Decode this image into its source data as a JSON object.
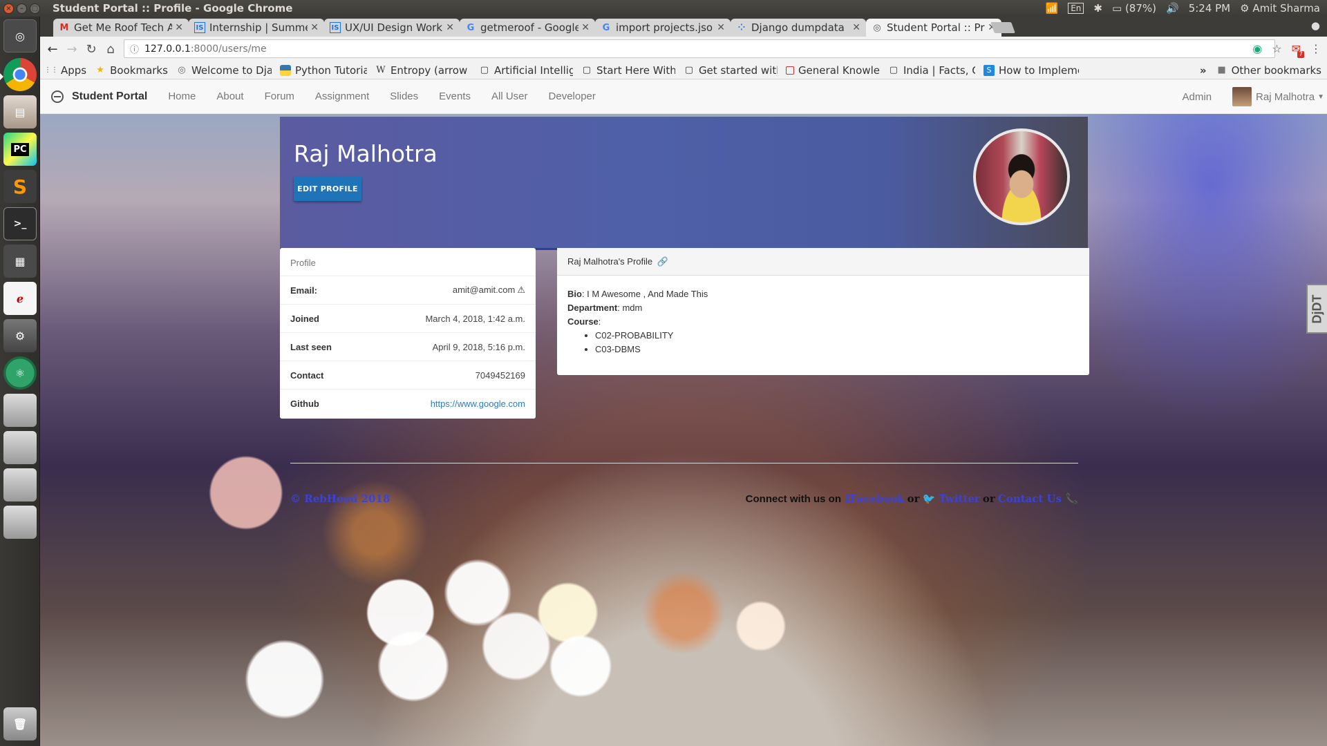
{
  "os": {
    "window_title": "Student Portal :: Profile - Google Chrome",
    "keyboard": "En",
    "battery": "(87%)",
    "time": "5:24 PM",
    "user": "Amit Sharma"
  },
  "launcher": {
    "items": [
      "ubuntu-dash",
      "chrome",
      "files",
      "pycharm",
      "sublime-text",
      "terminal",
      "workspace",
      "disk-utility",
      "settings",
      "atom",
      "drive-1",
      "drive-2",
      "drive-3",
      "drive-4",
      "trash"
    ],
    "pycharm_label": "PC"
  },
  "browser": {
    "tabs": [
      {
        "icon": "M",
        "title": "Get Me Roof Tech A"
      },
      {
        "icon": "IS",
        "title": "Internship | Summe"
      },
      {
        "icon": "IS",
        "title": "UX/UI Design Work"
      },
      {
        "icon": "G",
        "title": "getmeroof - Google"
      },
      {
        "icon": "G",
        "title": "import projects.jso"
      },
      {
        "icon": "⁘",
        "title": "Django dumpdata"
      },
      {
        "icon": "◎",
        "title": "Student Portal :: Pr"
      }
    ],
    "url_host": "127.0.0.1",
    "url_path": ":8000/users/me",
    "mail_badge": "7",
    "bookmarks": [
      {
        "icon": "⋮⋮",
        "label": "Apps"
      },
      {
        "icon": "★",
        "label": "Bookmarks"
      },
      {
        "icon": "◎",
        "label": "Welcome to Dja"
      },
      {
        "icon": "",
        "label": "Python Tutorial:"
      },
      {
        "icon": "W",
        "label": "Entropy (arrow c"
      },
      {
        "icon": "▢",
        "label": "Artificial Intellig"
      },
      {
        "icon": "▢",
        "label": "Start Here With"
      },
      {
        "icon": "▢",
        "label": "Get started with"
      },
      {
        "icon": "",
        "label": "General Knowlec"
      },
      {
        "icon": "▢",
        "label": "India | Facts, Cul"
      },
      {
        "icon": "S",
        "label": "How to Impleme"
      }
    ],
    "more_bookmarks": "»",
    "other_bookmarks": "Other bookmarks"
  },
  "site": {
    "brand": "Student Portal",
    "nav": [
      "Home",
      "About",
      "Forum",
      "Assignment",
      "Slides",
      "Events",
      "All User",
      "Developer"
    ],
    "admin": "Admin",
    "current_user": "Raj Malhotra"
  },
  "profile": {
    "name": "Raj Malhotra",
    "edit_button": "EDIT PROFILE",
    "card_title": "Profile",
    "rows": [
      {
        "label": "Email:",
        "value": "amit@amit.com"
      },
      {
        "label": "Joined",
        "value": "March 4, 2018, 1:42 a.m."
      },
      {
        "label": "Last seen",
        "value": "April 9, 2018, 5:16 p.m."
      },
      {
        "label": "Contact",
        "value": "7049452169"
      },
      {
        "label": "Github",
        "value": "https://www.google.com"
      }
    ],
    "bio_card_title": "Raj Malhotra's Profile",
    "bio_label": "Bio",
    "bio": ": I M Awesome , And Made This",
    "department_label": "Department",
    "department": ": mdm",
    "course_label": "Course",
    "course_suffix": ":",
    "courses": [
      "C02-PROBABILITY",
      "C03-DBMS"
    ]
  },
  "footer": {
    "copyright": "© RebHood 2018",
    "connect_text": "Connect with us on",
    "facebook": "Facebook",
    "or1": "or",
    "twitter": "Twitter",
    "or2": "or",
    "contact": "Contact Us"
  },
  "debug_toolbar": "DjDT"
}
